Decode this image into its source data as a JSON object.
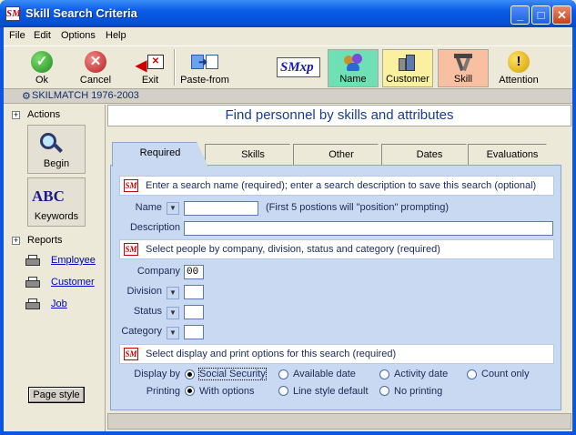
{
  "window": {
    "title": "Skill Search Criteria"
  },
  "menu": {
    "file": "File",
    "edit": "Edit",
    "options": "Options",
    "help": "Help"
  },
  "toolbar": {
    "ok": "Ok",
    "cancel": "Cancel",
    "exit": "Exit",
    "paste_from": "Paste-from",
    "logo_text": "SMxp",
    "name": "Name",
    "customer": "Customer",
    "skill": "Skill",
    "attention": "Attention"
  },
  "status_strip": "SKILMATCH 1976-2003",
  "left": {
    "actions": "Actions",
    "begin": "Begin",
    "keywords": "Keywords",
    "reports": "Reports",
    "employee": "Employee",
    "customer": "Customer",
    "job": "Job",
    "page_style": "Page style"
  },
  "main": {
    "heading": "Find personnel by skills and attributes",
    "tabs": [
      "Required",
      "Skills",
      "Other",
      "Dates",
      "Evaluations"
    ],
    "banner1": "Enter a search name (required); enter a search description to save this search (optional)",
    "name_label": "Name",
    "name_value": "",
    "name_hint": "(First 5 postions will \"position\" prompting)",
    "description_label": "Description",
    "description_value": "",
    "banner2": "Select people by company, division, status and category (required)",
    "company_label": "Company",
    "company_value": "00",
    "division_label": "Division",
    "division_value": "",
    "status_label": "Status",
    "status_value": "",
    "category_label": "Category",
    "category_value": "",
    "banner3": "Select display and print options for this search (required)",
    "display_label": "Display by",
    "display_options": [
      "Social Security",
      "Available date",
      "Activity date",
      "Count only"
    ],
    "display_selected": "Social Security",
    "printing_label": "Printing",
    "printing_options": [
      "With options",
      "Line style default",
      "No printing"
    ],
    "printing_selected": "With options"
  },
  "colors": {
    "title_bar": "#0a5be6",
    "panel": "#c9d9f1",
    "heading_text": "#1a3c8c"
  }
}
